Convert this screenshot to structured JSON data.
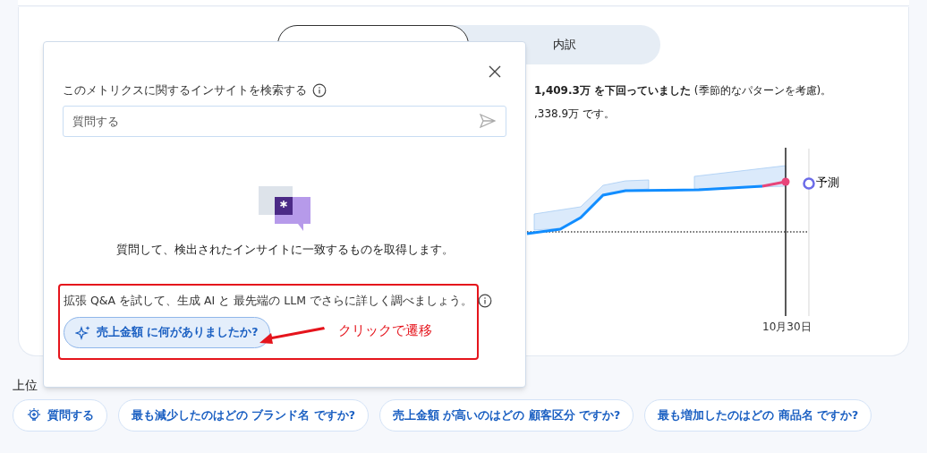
{
  "tabs": [
    {
      "selected": true
    },
    {
      "label": "内訳",
      "selected": false
    }
  ],
  "summary": [
    "**1,409.3万 を下回っていました** (季節的なパターンを考慮)。",
    ",338.9万 です。"
  ],
  "chart": {
    "kind": "forecast",
    "date_label": "10月30日",
    "forecast_label": "予測"
  },
  "popover": {
    "search_label": "このメトリクスに関するインサイトを検索する",
    "search": {
      "placeholder": "質問する"
    },
    "empty_message": "質問して、検出されたインサイトに一致するものを取得します。",
    "promo": "拡張 Q&A を試して、生成 AI と 最先端の LLM でさらに詳しく調べましょう。",
    "suggestion": "**売上金額** に何がありましたか?"
  },
  "annotation": {
    "text": "クリックで遷移"
  },
  "section_label": "上位",
  "chips": [
    {
      "kind": "ask",
      "label": "質問する"
    },
    {
      "kind": "question",
      "label": "最も減少したのはどの ブランド名 ですか?"
    },
    {
      "kind": "question",
      "label": "売上金額 が高いのはどの 顧客区分 ですか?"
    },
    {
      "kind": "question",
      "label": "最も増加したのはどの 商品名 ですか?"
    }
  ]
}
